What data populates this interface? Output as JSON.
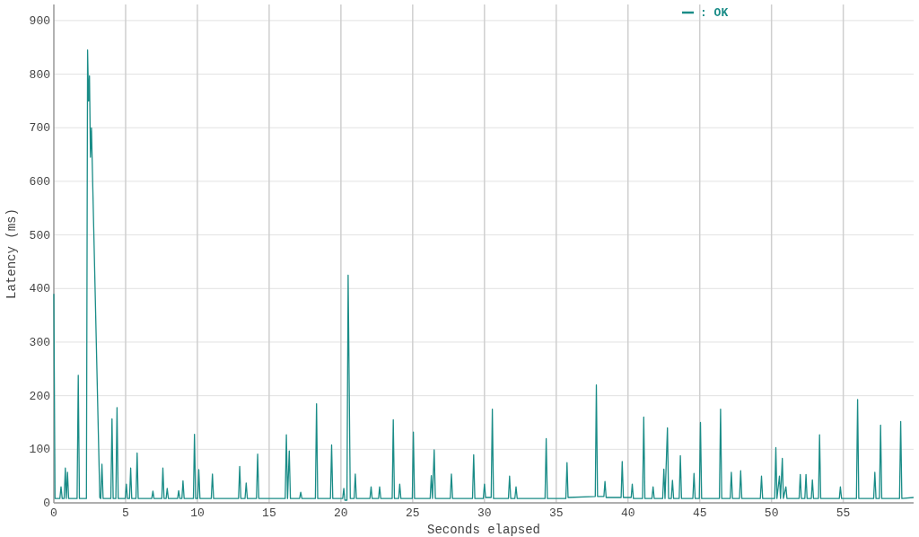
{
  "chart_data": {
    "type": "line",
    "xlabel": "Seconds elapsed",
    "ylabel": "Latency (ms)",
    "xlim": [
      0,
      59.9
    ],
    "ylim": [
      0,
      930
    ],
    "xticks": [
      0,
      5,
      10,
      15,
      20,
      25,
      30,
      35,
      40,
      45,
      50,
      55
    ],
    "yticks": [
      0,
      100,
      200,
      300,
      400,
      500,
      600,
      700,
      800,
      900
    ],
    "x": [
      0,
      0.08,
      0.42,
      0.5,
      0.58,
      0.72,
      0.8,
      0.87,
      0.95,
      1.03,
      1.62,
      1.7,
      1.78,
      2.27,
      2.35,
      2.42,
      2.48,
      2.55,
      2.62,
      3.2,
      3.27,
      3.35,
      3.43,
      3.97,
      4.05,
      4.13,
      4.32,
      4.4,
      4.48,
      4.97,
      5.05,
      5.13,
      5.27,
      5.35,
      5.43,
      5.72,
      5.8,
      5.88,
      6.82,
      6.9,
      6.98,
      7.52,
      7.6,
      7.68,
      7.82,
      7.9,
      7.98,
      8.62,
      8.7,
      8.78,
      8.92,
      9,
      9.08,
      9.72,
      9.8,
      9.88,
      10.02,
      10.1,
      10.18,
      10.97,
      11.05,
      11.13,
      12.87,
      12.95,
      13.03,
      13.32,
      13.4,
      13.48,
      14.12,
      14.2,
      14.28,
      16.12,
      16.2,
      16.28,
      16.4,
      16.48,
      17.12,
      17.2,
      17.28,
      18.22,
      18.3,
      18.38,
      19.27,
      19.35,
      19.43,
      20.12,
      20.2,
      20.28,
      20.42,
      20.5,
      20.65,
      20.92,
      21,
      21.08,
      22.02,
      22.1,
      22.18,
      22.62,
      22.7,
      22.78,
      23.57,
      23.65,
      23.73,
      24.02,
      24.1,
      24.18,
      24.97,
      25.05,
      25.13,
      26.22,
      26.3,
      26.38,
      26.5,
      26.58,
      27.62,
      27.7,
      27.78,
      29.17,
      29.25,
      29.33,
      29.92,
      30,
      30.08,
      30.47,
      30.55,
      30.63,
      31.67,
      31.75,
      31.83,
      32.12,
      32.2,
      32.28,
      34.22,
      34.3,
      34.38,
      35.67,
      35.75,
      35.83,
      37.72,
      37.8,
      37.88,
      38.32,
      38.4,
      38.48,
      39.52,
      39.6,
      39.68,
      40.22,
      40.3,
      40.38,
      41.02,
      41.1,
      41.18,
      41.67,
      41.75,
      41.83,
      42.42,
      42.5,
      42.58,
      42.75,
      42.83,
      43.02,
      43.1,
      43.18,
      43.57,
      43.65,
      43.73,
      44.52,
      44.6,
      44.68,
      44.97,
      45.05,
      45.13,
      46.37,
      46.45,
      46.53,
      47.12,
      47.2,
      47.28,
      47.77,
      47.85,
      47.93,
      49.22,
      49.3,
      49.38,
      50.22,
      50.3,
      50.38,
      50.55,
      50.63,
      50.75,
      50.83,
      51,
      51.08,
      51.92,
      52,
      52.08,
      52.32,
      52.4,
      52.48,
      52.77,
      52.85,
      52.93,
      53.27,
      53.35,
      53.43,
      54.72,
      54.8,
      54.88,
      55.92,
      56,
      56.08,
      57.12,
      57.2,
      57.28,
      57.52,
      57.6,
      57.68,
      58.92,
      59,
      59.08,
      59.9
    ],
    "series": [
      {
        "name": "OK",
        "color": "#1a8c87",
        "values": [
          390,
          8,
          8,
          30,
          8,
          8,
          65,
          8,
          57,
          8,
          8,
          238,
          8,
          8,
          845,
          750,
          797,
          645,
          700,
          10,
          8,
          72,
          8,
          8,
          157,
          8,
          8,
          178,
          8,
          8,
          35,
          8,
          8,
          65,
          8,
          8,
          93,
          8,
          8,
          22,
          8,
          8,
          65,
          8,
          8,
          27,
          8,
          8,
          23,
          8,
          8,
          41,
          8,
          8,
          128,
          8,
          8,
          62,
          8,
          8,
          54,
          8,
          8,
          68,
          8,
          8,
          37,
          8,
          8,
          91,
          8,
          8,
          127,
          8,
          97,
          8,
          8,
          20,
          8,
          8,
          185,
          8,
          8,
          108,
          8,
          8,
          27,
          5,
          5,
          425,
          8,
          8,
          54,
          8,
          8,
          30,
          8,
          8,
          30,
          8,
          8,
          155,
          8,
          8,
          35,
          8,
          8,
          132,
          8,
          8,
          51,
          8,
          99,
          8,
          8,
          54,
          8,
          8,
          90,
          8,
          8,
          35,
          10,
          10,
          175,
          8,
          8,
          50,
          8,
          8,
          30,
          8,
          8,
          120,
          8,
          8,
          75,
          10,
          12,
          220,
          12,
          12,
          40,
          10,
          10,
          77,
          10,
          10,
          35,
          8,
          8,
          160,
          8,
          8,
          30,
          8,
          8,
          63,
          8,
          140,
          8,
          8,
          42,
          8,
          8,
          88,
          8,
          8,
          55,
          8,
          8,
          150,
          8,
          8,
          175,
          8,
          8,
          57,
          8,
          8,
          60,
          8,
          8,
          50,
          8,
          8,
          103,
          8,
          50,
          8,
          83,
          8,
          30,
          8,
          8,
          53,
          8,
          8,
          53,
          8,
          8,
          43,
          8,
          8,
          127,
          8,
          8,
          30,
          8,
          8,
          193,
          8,
          8,
          57,
          8,
          8,
          145,
          8,
          8,
          152,
          8,
          10
        ]
      }
    ],
    "grid": true
  },
  "legend": {
    "separator": ":"
  }
}
